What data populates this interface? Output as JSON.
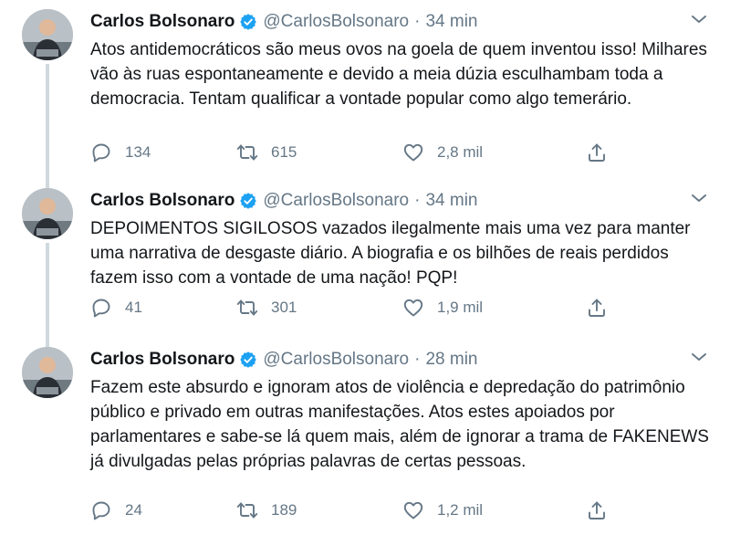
{
  "tweets": [
    {
      "name": "Carlos Bolsonaro",
      "handle": "@CarlosBolsonaro",
      "separator": "·",
      "time": "34 min",
      "text": "Atos antidemocráticos são meus ovos na goela de quem inventou isso! Milhares vão às ruas espontaneamente e devido a meia dúzia esculhambam toda a democracia. Tentam qualificar a vontade popular como algo temerário.",
      "replies": "134",
      "retweets": "615",
      "likes": "2,8 mil"
    },
    {
      "name": "Carlos Bolsonaro",
      "handle": "@CarlosBolsonaro",
      "separator": "·",
      "time": "34 min",
      "text": "DEPOIMENTOS SIGILOSOS vazados ilegalmente mais uma vez para manter uma narrativa de desgaste diário. A biografia e os bilhões de reais perdidos fazem isso com a vontade de uma nação! PQP!",
      "replies": "41",
      "retweets": "301",
      "likes": "1,9 mil"
    },
    {
      "name": "Carlos Bolsonaro",
      "handle": "@CarlosBolsonaro",
      "separator": "·",
      "time": "28 min",
      "text": "Fazem este absurdo e ignoram atos de violência e depredação do patrimônio público e privado em outras manifestações. Atos estes apoiados por parlamentares e sabe-se lá quem mais, além de ignorar a trama de FAKENEWS já divulgadas pelas próprias palavras de certas pessoas.",
      "replies": "24",
      "retweets": "189",
      "likes": "1,2 mil"
    }
  ],
  "icons": {
    "verified": "verified-badge-icon",
    "caret": "chevron-down-icon",
    "reply": "reply-icon",
    "retweet": "retweet-icon",
    "like": "heart-icon",
    "share": "share-icon"
  },
  "colors": {
    "text": "#14171a",
    "secondary": "#657786",
    "verified": "#1da1f2",
    "thread_line": "#cfd9de"
  }
}
